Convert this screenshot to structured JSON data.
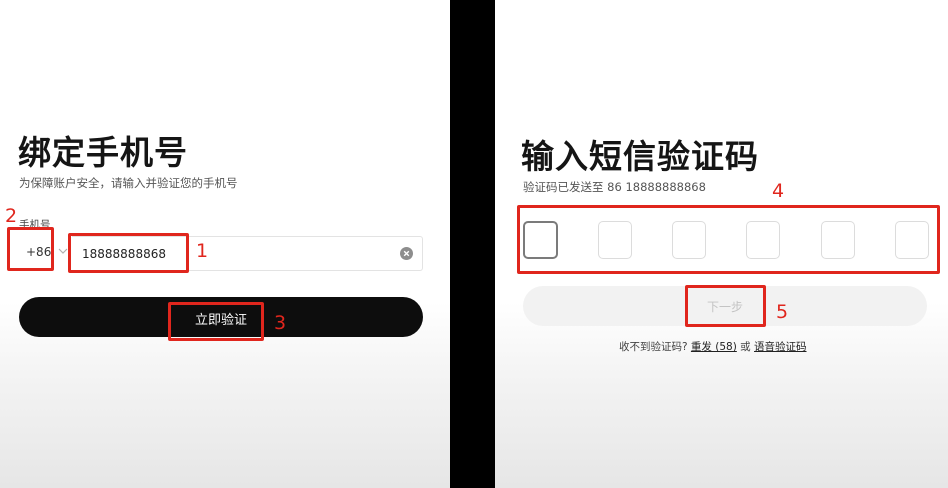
{
  "left": {
    "title": "绑定手机号",
    "subtitle": "为保障账户安全，请输入并验证您的手机号",
    "phone_label": "手机号",
    "country_code": "+86",
    "phone_value": "18888888868",
    "verify_button": "立即验证"
  },
  "right": {
    "title": "输入短信验证码",
    "subtitle": "验证码已发送至 86 18888888868",
    "code_boxes": [
      "",
      "",
      "",
      "",
      "",
      ""
    ],
    "next_button": "下一步",
    "helper_prefix": "收不到验证码?",
    "resend_link": "重发 (58)",
    "helper_or": "或",
    "voice_link": "语音验证码"
  },
  "annotations": [
    "1",
    "2",
    "3",
    "4",
    "5"
  ],
  "colors": {
    "annotation_red": "#e0261d",
    "primary_button": "#0d0d0d",
    "separator": "#000000"
  },
  "icons": {
    "chevron": "chevron-down-icon",
    "clear": "clear-circle-icon"
  }
}
